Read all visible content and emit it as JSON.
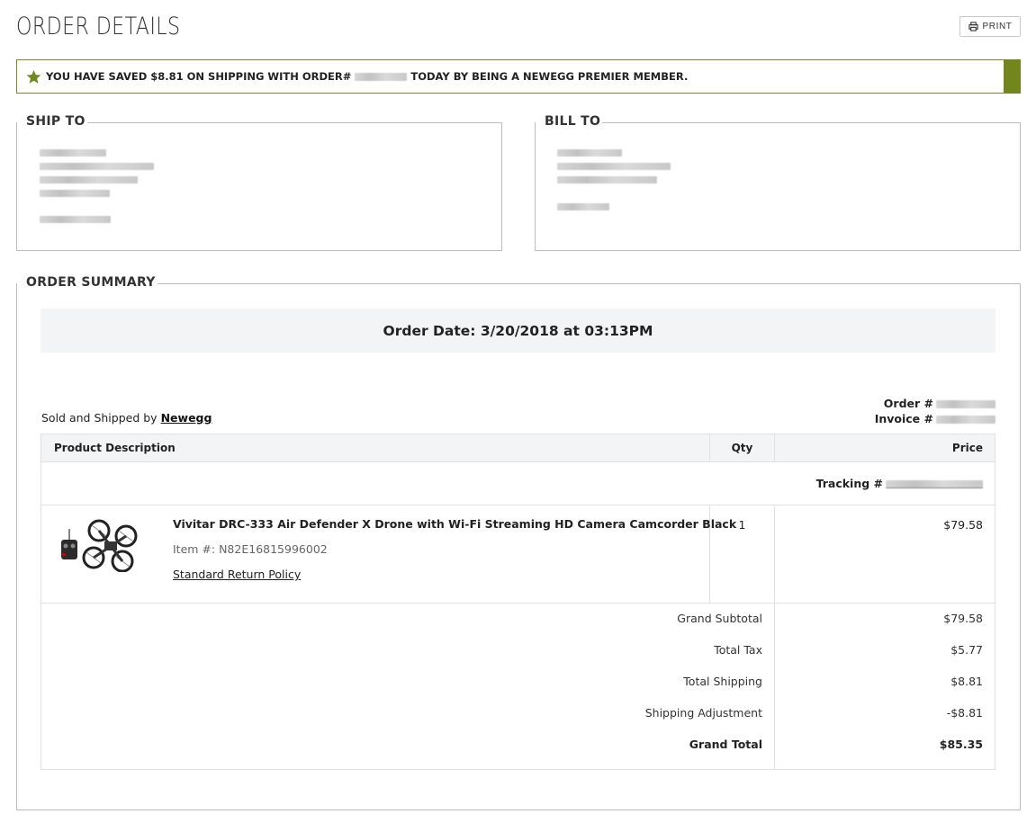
{
  "header": {
    "title": "ORDER DETAILS",
    "print_label": "PRINT"
  },
  "banner": {
    "text_before": "YOU HAVE SAVED $8.81 ON SHIPPING WITH ORDER#",
    "text_after": "TODAY BY BEING A NEWEGG PREMIER MEMBER.",
    "accent_color": "#72861c"
  },
  "ship_to": {
    "title": "SHIP TO"
  },
  "bill_to": {
    "title": "BILL TO"
  },
  "summary": {
    "title": "ORDER SUMMARY",
    "order_date": "Order Date: 3/20/2018 at 03:13PM",
    "sold_by_prefix": "Sold and Shipped by",
    "seller": "Newegg",
    "order_label": "Order #",
    "invoice_label": "Invoice #"
  },
  "table": {
    "col_desc": "Product Description",
    "col_qty": "Qty",
    "col_price": "Price",
    "tracking_label": "Tracking #",
    "item": {
      "name": "Vivitar DRC-333 Air Defender X Drone with Wi-Fi Streaming HD Camera Camcorder Black",
      "item_no": "Item #: N82E16815996002",
      "return_policy": "Standard Return Policy",
      "qty": "1",
      "price": "$79.58"
    }
  },
  "totals": {
    "grand_subtotal_label": "Grand Subtotal",
    "grand_subtotal": "$79.58",
    "total_tax_label": "Total Tax",
    "total_tax": "$5.77",
    "total_shipping_label": "Total Shipping",
    "total_shipping": "$8.81",
    "shipping_adjustment_label": "Shipping Adjustment",
    "shipping_adjustment": "-$8.81",
    "grand_total_label": "Grand Total",
    "grand_total": "$85.35"
  }
}
